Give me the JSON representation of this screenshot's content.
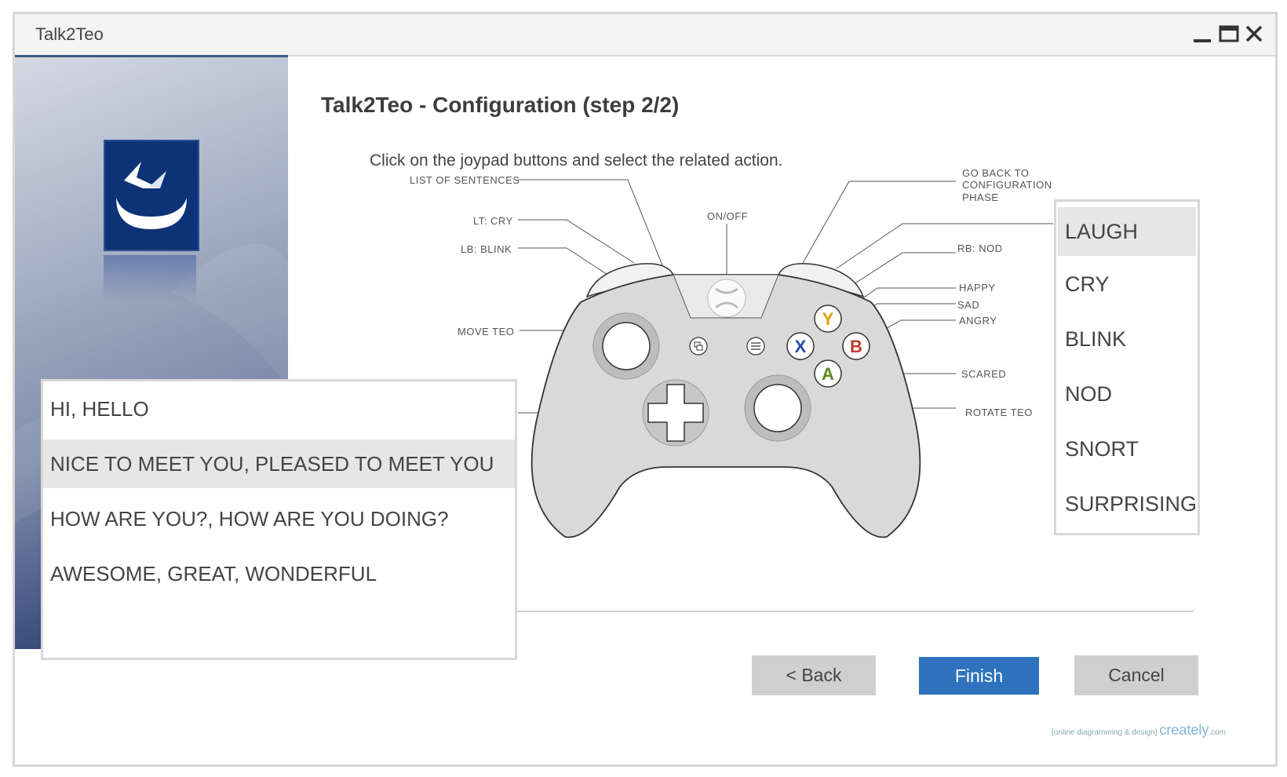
{
  "window": {
    "title": "Talk2Teo"
  },
  "page": {
    "title": "Talk2Teo - Configuration (step 2/2)",
    "instructions": "Click on the joypad buttons and select the related action."
  },
  "controller_labels": {
    "list_of_sentences": "LIST OF SENTENCES",
    "lt": "LT: CRY",
    "lb": "LB: BLINK",
    "move": "MOVE TEO",
    "onoff": "ON/OFF",
    "goback_1": "GO BACK TO",
    "goback_2": "CONFIGURATION",
    "goback_3": "PHASE",
    "rb": "RB: NOD",
    "happy": "HAPPY",
    "sad": "SAD",
    "angry": "ANGRY",
    "scared": "SCARED",
    "rotate": "ROTATE TEO"
  },
  "face_buttons": {
    "y": "Y",
    "x": "X",
    "b": "B",
    "a": "A"
  },
  "actions_dropdown": {
    "items": [
      "LAUGH",
      "CRY",
      "BLINK",
      "NOD",
      "SNORT",
      "SURPRISING"
    ],
    "selected": "LAUGH"
  },
  "sentences_dropdown": {
    "items": [
      "HI, HELLO",
      "NICE TO MEET YOU, PLEASED TO MEET YOU",
      "HOW ARE YOU?, HOW ARE YOU DOING?",
      "AWESOME, GREAT, WONDERFUL"
    ],
    "selected": "NICE TO MEET YOU, PLEASED TO MEET YOU"
  },
  "buttons": {
    "back": "< Back",
    "finish": "Finish",
    "cancel": "Cancel"
  },
  "watermark": {
    "small": "[online diagramming & design]",
    "brand": "creately",
    "suffix": ".com"
  },
  "colors": {
    "accent": "#2e72bd",
    "button_gray": "#cfcfcf",
    "selected_row": "#e6e6e6",
    "y_button": "#e0a100",
    "x_button": "#2c4aa8",
    "b_button": "#c0392b",
    "a_button": "#5a8a1e"
  }
}
